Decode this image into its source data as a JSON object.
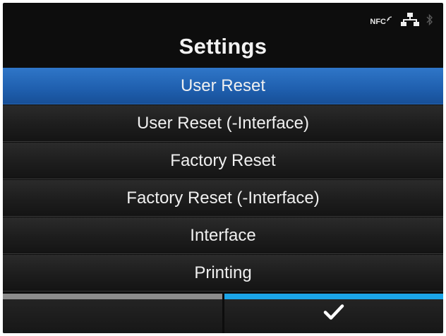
{
  "status": {
    "nfc_label": "NFC",
    "icons": [
      "nfc-icon",
      "network-icon",
      "bluetooth-icon"
    ]
  },
  "header": {
    "title": "Settings"
  },
  "menu": {
    "items": [
      {
        "label": "User Reset",
        "selected": true
      },
      {
        "label": "User Reset (-Interface)",
        "selected": false
      },
      {
        "label": "Factory Reset",
        "selected": false
      },
      {
        "label": "Factory Reset (-Interface)",
        "selected": false
      },
      {
        "label": "Interface",
        "selected": false
      },
      {
        "label": "Printing",
        "selected": false
      }
    ]
  },
  "softkeys": {
    "left": {
      "icon": "none",
      "indicator_color": "#8c8c8c"
    },
    "right": {
      "icon": "checkmark-icon",
      "indicator_color": "#1ba5e8"
    }
  },
  "colors": {
    "selected_bg": "#1f5fae",
    "screen_bg": "#0d0d0d",
    "accent": "#1ba5e8"
  }
}
